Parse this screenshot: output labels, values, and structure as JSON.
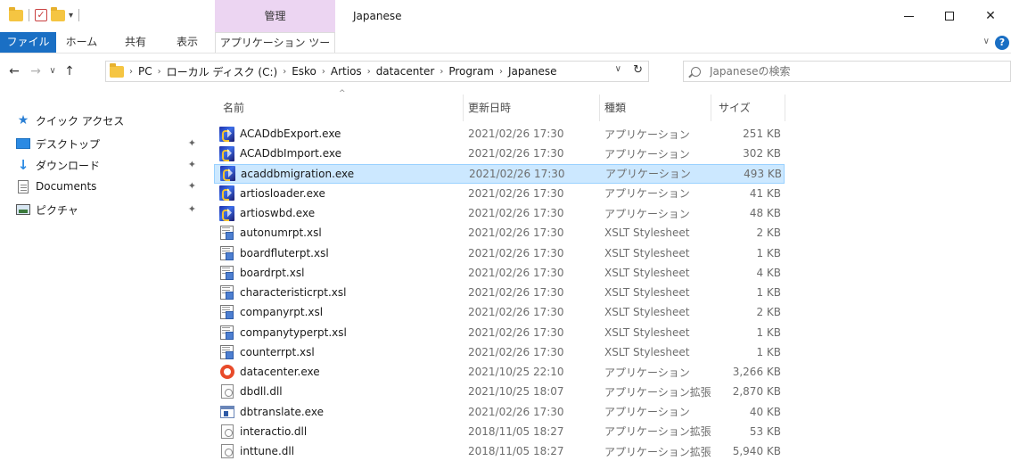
{
  "window": {
    "title": "Japanese",
    "context_tab": "管理"
  },
  "ribbon": {
    "tabs": [
      "ファイル",
      "ホーム",
      "共有",
      "表示",
      "アプリケーション ツール"
    ]
  },
  "address": {
    "crumbs": [
      "PC",
      "ローカル ディスク (C:)",
      "Esko",
      "Artios",
      "datacenter",
      "Program",
      "Japanese"
    ]
  },
  "search": {
    "placeholder": "Japaneseの検索"
  },
  "sidebar": {
    "items": [
      {
        "label": "クイック アクセス",
        "icon": "star-icon"
      },
      {
        "label": "デスクトップ",
        "icon": "desktop-icon"
      },
      {
        "label": "ダウンロード",
        "icon": "download-icon"
      },
      {
        "label": "Documents",
        "icon": "documents-icon"
      },
      {
        "label": "ピクチャ",
        "icon": "pictures-icon"
      }
    ]
  },
  "columns": {
    "name": "名前",
    "date": "更新日時",
    "type": "種類",
    "size": "サイズ"
  },
  "files": [
    {
      "name": "ACADdbExport.exe",
      "date": "2021/02/26 17:30",
      "type": "アプリケーション",
      "size": "251 KB",
      "icon": "artios-app-icon"
    },
    {
      "name": "ACADdbImport.exe",
      "date": "2021/02/26 17:30",
      "type": "アプリケーション",
      "size": "302 KB",
      "icon": "artios-app-icon"
    },
    {
      "name": "acaddbmigration.exe",
      "date": "2021/02/26 17:30",
      "type": "アプリケーション",
      "size": "493 KB",
      "icon": "artios-app-icon",
      "selected": true
    },
    {
      "name": "artiosloader.exe",
      "date": "2021/02/26 17:30",
      "type": "アプリケーション",
      "size": "41 KB",
      "icon": "artios-app-icon"
    },
    {
      "name": "artioswbd.exe",
      "date": "2021/02/26 17:30",
      "type": "アプリケーション",
      "size": "48 KB",
      "icon": "artios-app-icon"
    },
    {
      "name": "autonumrpt.xsl",
      "date": "2021/02/26 17:30",
      "type": "XSLT Stylesheet",
      "size": "2 KB",
      "icon": "xslt-file-icon"
    },
    {
      "name": "boardfluterpt.xsl",
      "date": "2021/02/26 17:30",
      "type": "XSLT Stylesheet",
      "size": "1 KB",
      "icon": "xslt-file-icon"
    },
    {
      "name": "boardrpt.xsl",
      "date": "2021/02/26 17:30",
      "type": "XSLT Stylesheet",
      "size": "4 KB",
      "icon": "xslt-file-icon"
    },
    {
      "name": "characteristicrpt.xsl",
      "date": "2021/02/26 17:30",
      "type": "XSLT Stylesheet",
      "size": "1 KB",
      "icon": "xslt-file-icon"
    },
    {
      "name": "companyrpt.xsl",
      "date": "2021/02/26 17:30",
      "type": "XSLT Stylesheet",
      "size": "2 KB",
      "icon": "xslt-file-icon"
    },
    {
      "name": "companytyperpt.xsl",
      "date": "2021/02/26 17:30",
      "type": "XSLT Stylesheet",
      "size": "1 KB",
      "icon": "xslt-file-icon"
    },
    {
      "name": "counterrpt.xsl",
      "date": "2021/02/26 17:30",
      "type": "XSLT Stylesheet",
      "size": "1 KB",
      "icon": "xslt-file-icon"
    },
    {
      "name": "datacenter.exe",
      "date": "2021/10/25 22:10",
      "type": "アプリケーション",
      "size": "3,266 KB",
      "icon": "datacenter-app-icon"
    },
    {
      "name": "dbdll.dll",
      "date": "2021/10/25 18:07",
      "type": "アプリケーション拡張",
      "size": "2,870 KB",
      "icon": "dll-file-icon"
    },
    {
      "name": "dbtranslate.exe",
      "date": "2021/02/26 17:30",
      "type": "アプリケーション",
      "size": "40 KB",
      "icon": "generic-app-icon"
    },
    {
      "name": "interactio.dll",
      "date": "2018/11/05 18:27",
      "type": "アプリケーション拡張",
      "size": "53 KB",
      "icon": "dll-file-icon"
    },
    {
      "name": "inttune.dll",
      "date": "2018/11/05 18:27",
      "type": "アプリケーション拡張",
      "size": "5,940 KB",
      "icon": "dll-file-icon"
    }
  ],
  "colors": {
    "file_tab": "#1a6fc4",
    "context_tab": "#ecd5f2",
    "selection": "#cce8ff",
    "selection_border": "#99d1ff"
  }
}
